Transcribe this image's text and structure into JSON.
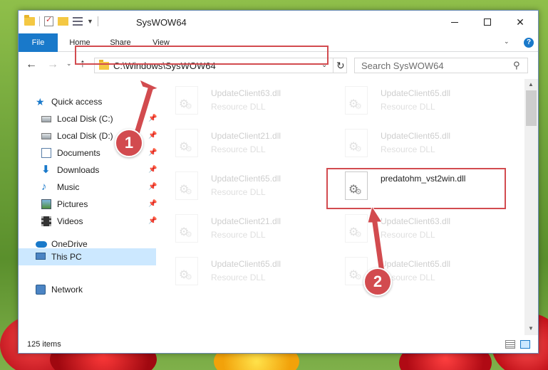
{
  "window": {
    "title": "SysWOW64"
  },
  "ribbon": {
    "tabs": [
      {
        "label": "File"
      },
      {
        "label": "Home"
      },
      {
        "label": "Share"
      },
      {
        "label": "View"
      }
    ]
  },
  "address": {
    "path": "C:\\Windows\\SysWOW64"
  },
  "search": {
    "placeholder": "Search SysWOW64"
  },
  "sidebar": {
    "items": [
      {
        "label": "Quick access",
        "icon": "star-icon"
      },
      {
        "label": "Local Disk (C:)",
        "icon": "drive-icon",
        "pinned": true
      },
      {
        "label": "Local Disk (D:)",
        "icon": "drive-icon",
        "pinned": true
      },
      {
        "label": "Documents",
        "icon": "documents-icon",
        "pinned": true
      },
      {
        "label": "Downloads",
        "icon": "download-icon",
        "pinned": true
      },
      {
        "label": "Music",
        "icon": "music-icon",
        "pinned": true
      },
      {
        "label": "Pictures",
        "icon": "pictures-icon",
        "pinned": true
      },
      {
        "label": "Videos",
        "icon": "videos-icon",
        "pinned": true
      },
      {
        "label": "OneDrive",
        "icon": "cloud-icon"
      },
      {
        "label": "This PC",
        "icon": "computer-icon",
        "selected": true
      },
      {
        "label": "Network",
        "icon": "network-icon"
      }
    ]
  },
  "files": [
    {
      "name": "UpdateClient63.dll",
      "type": "Resource DLL",
      "faded": true
    },
    {
      "name": "UpdateClient65.dll",
      "type": "Resource DLL",
      "faded": true
    },
    {
      "name": "UpdateClient21.dll",
      "type": "Resource DLL",
      "faded": true
    },
    {
      "name": "UpdateClient65.dll",
      "type": "Resource DLL",
      "faded": true
    },
    {
      "name": "UpdateClient65.dll",
      "type": "Resource DLL",
      "faded": true
    },
    {
      "name": "predatohm_vst2win.dll",
      "type": "",
      "faded": false
    },
    {
      "name": "UpdateClient21.dll",
      "type": "Resource DLL",
      "faded": true
    },
    {
      "name": "UpdateClient63.dll",
      "type": "Resource DLL",
      "faded": true
    },
    {
      "name": "UpdateClient65.dll",
      "type": "Resource DLL",
      "faded": true
    },
    {
      "name": "UpdateClient65.dll",
      "type": "Resource DLL",
      "faded": true
    }
  ],
  "status": {
    "item_count": "125 items"
  },
  "markers": {
    "step1": "1",
    "step2": "2"
  },
  "colors": {
    "accent": "#1979ca",
    "highlight": "#d24b4f",
    "selected_bg": "#cce8ff"
  }
}
